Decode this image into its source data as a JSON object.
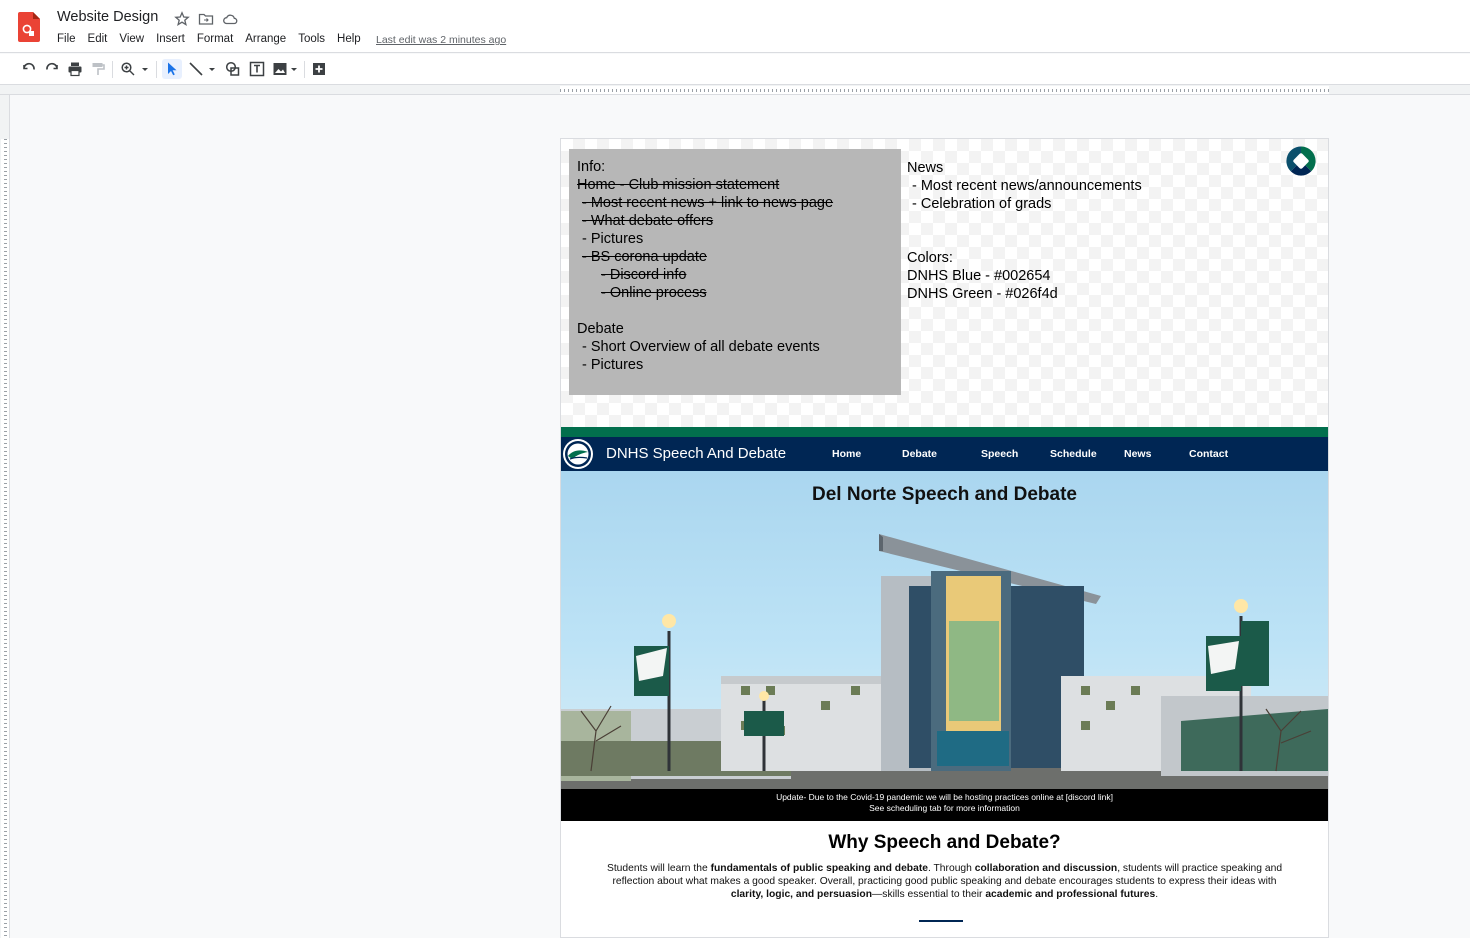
{
  "app": {
    "title": "Website Design",
    "menu": [
      "File",
      "Edit",
      "View",
      "Insert",
      "Format",
      "Arrange",
      "Tools",
      "Help"
    ],
    "last_edit": "Last edit was 2 minutes ago"
  },
  "toolbar": {
    "icons": [
      "undo-icon",
      "redo-icon",
      "print-icon",
      "paint-format-icon",
      "zoom-icon",
      "select-icon",
      "line-icon",
      "shape-icon",
      "text-box-icon",
      "image-icon",
      "add-comment-icon"
    ]
  },
  "notes": {
    "info_title": "Info:",
    "info_items": [
      {
        "text": "Home - Club mission statement",
        "strike": true,
        "indent": 0
      },
      {
        "text": "-  Most recent news + link to news page",
        "strike": true,
        "indent": 1
      },
      {
        "text": "-  What debate offers",
        "strike": true,
        "indent": 1
      },
      {
        "text": "-  Pictures",
        "strike": false,
        "indent": 1
      },
      {
        "text": "-  BS corona update",
        "strike": true,
        "indent": 1
      },
      {
        "text": "-  Discord info",
        "strike": true,
        "indent": 2
      },
      {
        "text": "-  Online process",
        "strike": true,
        "indent": 2
      }
    ],
    "debate_title": "Debate",
    "debate_items": [
      "-  Short Overview of all debate events",
      "-  Pictures"
    ],
    "news_title": "News",
    "news_items": [
      "-  Most recent news/announcements",
      "-  Celebration of grads"
    ],
    "colors_title": "Colors:",
    "colors_items": [
      "DNHS Blue - #002654",
      "DNHS Green - #026f4d"
    ]
  },
  "site": {
    "brand": "DNHS Speech And Debate",
    "nav": [
      "Home",
      "Debate",
      "Speech",
      "Schedule",
      "News",
      "Contact"
    ],
    "hero_title": "Del Norte Speech and Debate",
    "update_line1": "Update- Due to the Covid-19 pandemic we will be hosting practices online at [discord link]",
    "update_line2": "See scheduling tab for more information",
    "why_title": "Why Speech and Debate?",
    "why_parts": [
      {
        "t": "Students will learn the ",
        "b": false
      },
      {
        "t": "fundamentals of public speaking and debate",
        "b": true
      },
      {
        "t": ". Through ",
        "b": false
      },
      {
        "t": "collaboration and discussion",
        "b": true
      },
      {
        "t": ", students will practice speaking and reflection about what makes a good speaker. Overall, practicing good public speaking and debate encourages students to express their ideas with ",
        "b": false
      },
      {
        "t": "clarity, logic, and persuasion",
        "b": true
      },
      {
        "t": "—skills essential to their ",
        "b": false
      },
      {
        "t": "academic and professional futures",
        "b": true
      },
      {
        "t": ".",
        "b": false
      }
    ]
  },
  "colors": {
    "dnhs_blue": "#002654",
    "dnhs_green": "#026f4d",
    "app_red": "#ea4335"
  }
}
